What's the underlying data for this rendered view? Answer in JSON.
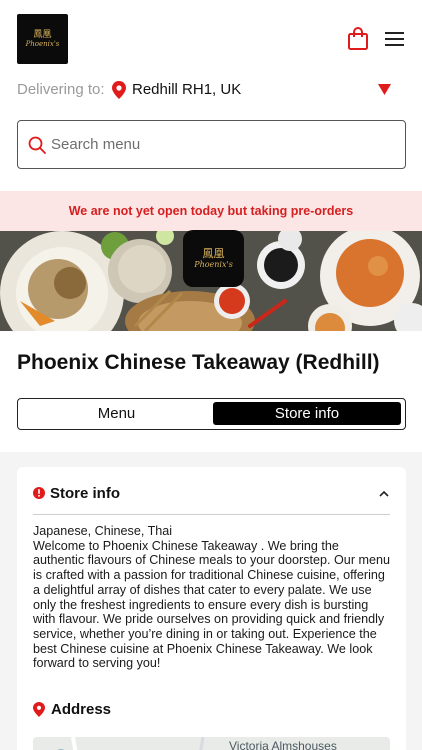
{
  "header": {
    "logo_glyphs": "鳳凰",
    "logo_name": "Phoenix's",
    "bag_icon": "shopping-bag-icon",
    "menu_icon": "hamburger-menu-icon"
  },
  "delivery": {
    "label": "Delivering to:",
    "location": "Redhill RH1, UK",
    "pin_icon": "location-pin-icon",
    "caret_icon": "caret-down-icon"
  },
  "search": {
    "placeholder": "Search menu",
    "value": "",
    "icon": "search-icon"
  },
  "notice": {
    "text": "We are not yet open today but taking pre-orders"
  },
  "restaurant": {
    "name": "Phoenix Chinese Takeaway (Redhill)"
  },
  "tabs": [
    {
      "label": "Menu",
      "active": false
    },
    {
      "label": "Store info",
      "active": true
    }
  ],
  "store_info": {
    "heading": "Store info",
    "cuisines": "Japanese, Chinese, Thai",
    "description": "Welcome to Phoenix Chinese Takeaway . We bring the authentic flavours of Chinese meals to your doorstep. Our menu is crafted with a passion for traditional Chinese cuisine, offering a delightful array of dishes that cater to every palate. We use only the freshest ingredients to ensure every dish is bursting with flavour. We pride ourselves on providing quick and friendly service, whether you’re dining in or taking out. Experience the best Chinese cuisine at Phoenix Chinese Takeaway. We look forward to serving you!",
    "address_heading": "Address",
    "map_label": "Victoria Almshouses"
  },
  "colors": {
    "accent": "#e01b1b",
    "notice_bg": "#fbe5e5",
    "logo_gold": "#d7b15a"
  }
}
